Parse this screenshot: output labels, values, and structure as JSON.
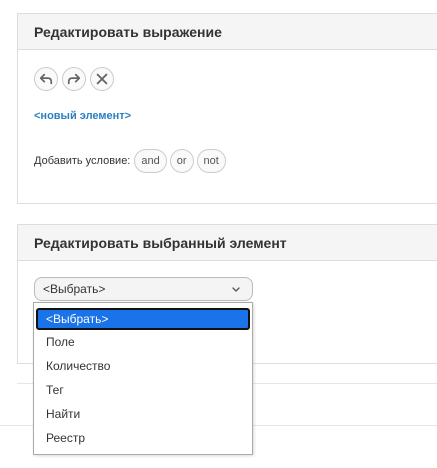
{
  "expression_panel": {
    "title": "Редактировать выражение",
    "toolbar": [
      {
        "name": "undo-icon",
        "label": "undo"
      },
      {
        "name": "redo-icon",
        "label": "redo"
      },
      {
        "name": "clear-icon",
        "label": "clear"
      }
    ],
    "new_element": "<новый элемент>",
    "condition_label": "Добавить условие:",
    "operators": [
      "and",
      "or",
      "not"
    ]
  },
  "selected_panel": {
    "title": "Редактировать выбранный элемент",
    "select_value": "<Выбрать>",
    "options": [
      "<Выбрать>",
      "Поле",
      "Количество",
      "Тег",
      "Найти",
      "Реестр"
    ],
    "selected_index": 0
  },
  "colors": {
    "accent_link": "#2a7fc1",
    "selected_option": "#1a73e8",
    "header_bg": "#f5f5f5"
  }
}
